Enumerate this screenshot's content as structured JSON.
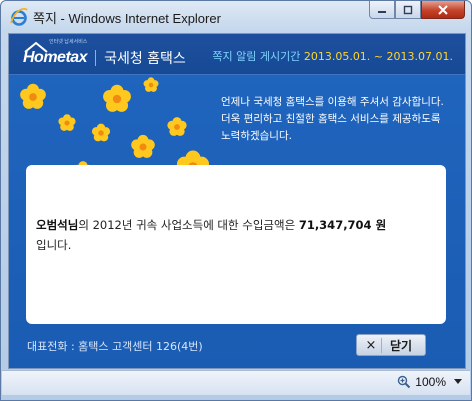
{
  "window": {
    "title": "쪽지 - Windows Internet Explorer",
    "buttons": [
      "minimize",
      "maximize",
      "close"
    ]
  },
  "header": {
    "logo_tagline": "인터넷 납세서비스",
    "logo_text": "Hometax",
    "org_name": "국세청 홈택스",
    "notice_label": "쪽지 알림 게시기간",
    "notice_date": "2013.05.01. ~ 2013.07.01."
  },
  "greeting": {
    "line1": "언제나 국세청 홈택스를 이용해 주셔서 감사합니다.",
    "line2": "더욱 편리하고 친절한 홈택스 서비스를 제공하도록",
    "line3": "노력하겠습니다."
  },
  "message": {
    "name": "오범석님",
    "middle": "의 2012년 귀속 사업소득에 대한 수입금액은",
    "amount": "71,347,704 원",
    "end": "입니다."
  },
  "footer": {
    "phone_text": "대표전화 : 홈택스 고객센터 126(4번)",
    "close_label": "닫기",
    "close_icon": "×"
  },
  "statusbar": {
    "zoom": "100%"
  },
  "colors": {
    "header_bg": "#174a95",
    "body_bg": "#1e5fb6",
    "notice_label": "#7fd3ff",
    "notice_date": "#ffd530",
    "flower": "#ffc81e"
  }
}
